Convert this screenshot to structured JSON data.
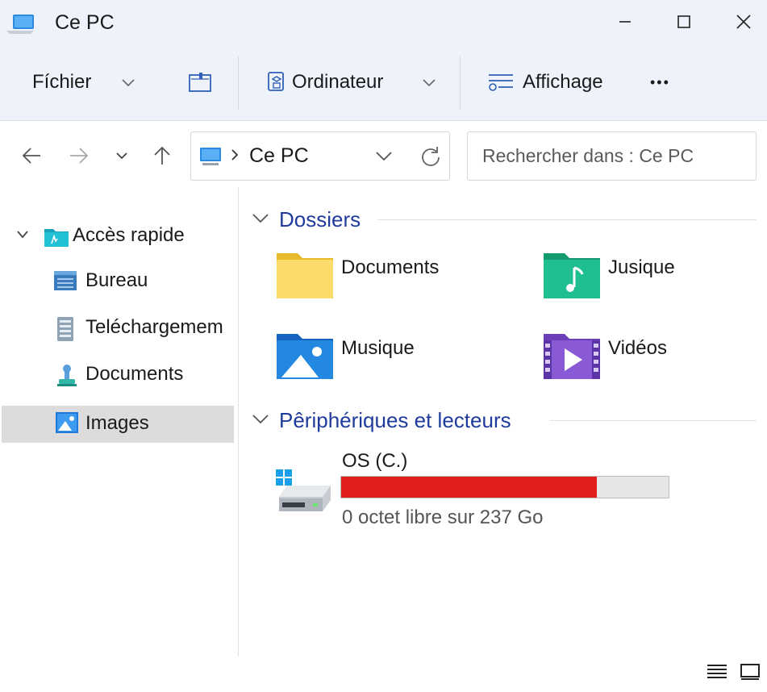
{
  "window": {
    "title": "Ce PC"
  },
  "toolbar": {
    "file_label": "Fíchier",
    "computer_label": "Ordinateur",
    "view_label": "Affichage",
    "more_label": "•••"
  },
  "nav": {
    "address_label": "Ce PC",
    "search_placeholder": "Rechercher dans : Ce PC"
  },
  "sidebar": {
    "items": [
      {
        "label": "Accès rapide",
        "icon": "quick-access-folder-icon"
      },
      {
        "label": "Bureau",
        "icon": "desktop-icon"
      },
      {
        "label": "Teléchargemem",
        "icon": "downloads-icon"
      },
      {
        "label": "Documents",
        "icon": "documents-icon"
      },
      {
        "label": "Images",
        "icon": "pictures-icon",
        "selected": true
      }
    ]
  },
  "sections": {
    "folders_title": "Dossiers",
    "devices_title": "Pêriphériques et lecteurs"
  },
  "folders": [
    {
      "label": "Documents",
      "icon": "documents-folder-icon"
    },
    {
      "label": "Jusique",
      "icon": "music-folder-icon"
    },
    {
      "label": "Musique",
      "icon": "pictures-folder-icon"
    },
    {
      "label": "Vidéos",
      "icon": "videos-folder-icon"
    }
  ],
  "drive": {
    "name": "OS (C.)",
    "used_fraction": 0.78,
    "free_text": "0 octet libre sur 237 Go",
    "fill_color": "#e01e1e"
  },
  "colors": {
    "accent": "#1f3b9c",
    "chrome_bg": "#eef3fb",
    "selection_bg": "#dcdcdc"
  }
}
